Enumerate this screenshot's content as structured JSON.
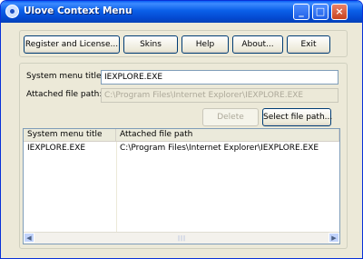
{
  "window": {
    "title": "Ulove Context Menu",
    "icon": "app-icon"
  },
  "titlebar_buttons": {
    "minimize": "_",
    "maximize": "□",
    "close": "×"
  },
  "toolbar": {
    "register_label": "Register and License...",
    "skins_label": "Skins",
    "help_label": "Help",
    "about_label": "About...",
    "exit_label": "Exit"
  },
  "form": {
    "menu_title_label": "System menu title:",
    "menu_title_value": "IEXPLORE.EXE",
    "file_path_label": "Attached file path:",
    "file_path_value": "C:\\Program Files\\Internet Explorer\\IEXPLORE.EXE",
    "delete_label": "Delete",
    "select_label": "Select file path..."
  },
  "list": {
    "columns": [
      "System menu title",
      "Attached file path"
    ],
    "rows": [
      [
        "IEXPLORE.EXE",
        "C:\\Program Files\\Internet Explorer\\IEXPLORE.EXE"
      ]
    ],
    "scroll_left": "◀",
    "scroll_right": "▶",
    "scroll_grip": "|||"
  }
}
